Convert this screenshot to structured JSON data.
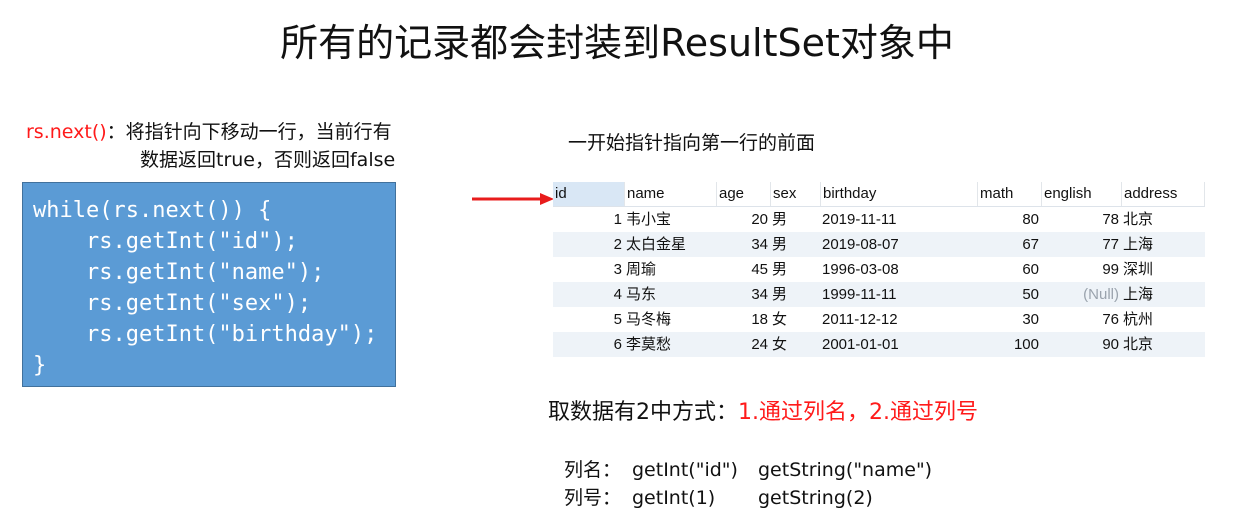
{
  "title": "所有的记录都会封装到ResultSet对象中",
  "rsnext": {
    "fn": "rs.next()",
    "line1": "：将指针向下移动一行，当前行有",
    "line2": "数据返回true，否则返回false"
  },
  "code": [
    "while(rs.next()) {",
    "    rs.getInt(\"id\");",
    "    rs.getInt(\"name\");",
    "    rs.getInt(\"sex\");",
    "    rs.getInt(\"birthday\");",
    "}"
  ],
  "start_note": "一开始指针指向第一行的前面",
  "arrow_color": "#e81c1c",
  "table": {
    "headers": [
      "id",
      "name",
      "age",
      "sex",
      "birthday",
      "math",
      "english",
      "address"
    ],
    "rows": [
      [
        "1",
        "韦小宝",
        "20",
        "男",
        "2019-11-11",
        "80",
        "78",
        "北京"
      ],
      [
        "2",
        "太白金星",
        "34",
        "男",
        "2019-08-07",
        "67",
        "77",
        "上海"
      ],
      [
        "3",
        "周瑜",
        "45",
        "男",
        "1996-03-08",
        "60",
        "99",
        "深圳"
      ],
      [
        "4",
        "马东",
        "34",
        "男",
        "1999-11-11",
        "50",
        "(Null)",
        "上海"
      ],
      [
        "5",
        "马冬梅",
        "18",
        "女",
        "2011-12-12",
        "30",
        "76",
        "杭州"
      ],
      [
        "6",
        "李莫愁",
        "24",
        "女",
        "2001-01-01",
        "100",
        "90",
        "北京"
      ]
    ]
  },
  "ways": {
    "prefix": "取数据有2中方式：",
    "highlight": "1.通过列名，2.通过列号"
  },
  "col_name": {
    "label": "列名：",
    "int_call": "getInt(\"id\")",
    "string_call": "getString(\"name\")"
  },
  "col_index": {
    "label": "列号：",
    "int_call": "getInt(1)",
    "string_call": "getString(2)"
  }
}
